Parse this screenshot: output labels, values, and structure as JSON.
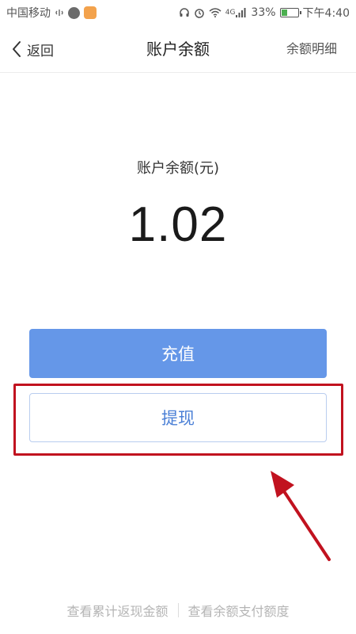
{
  "status_bar": {
    "carrier": "中国移动",
    "battery": "33%",
    "battery_level": 0.33,
    "network": "4G",
    "time": "下午4:40"
  },
  "nav": {
    "back_label": "返回",
    "title": "账户余额",
    "detail_link": "余额明细"
  },
  "balance": {
    "label": "账户余额(元)",
    "amount": "1.02"
  },
  "buttons": {
    "recharge": "充值",
    "withdraw": "提现"
  },
  "footer": {
    "cashback_link": "查看累计返现金额",
    "payment_limit_link": "查看余额支付额度"
  },
  "colors": {
    "primary": "#6597e8",
    "withdraw_text": "#4a7fd6",
    "annotation": "#c1121f"
  }
}
